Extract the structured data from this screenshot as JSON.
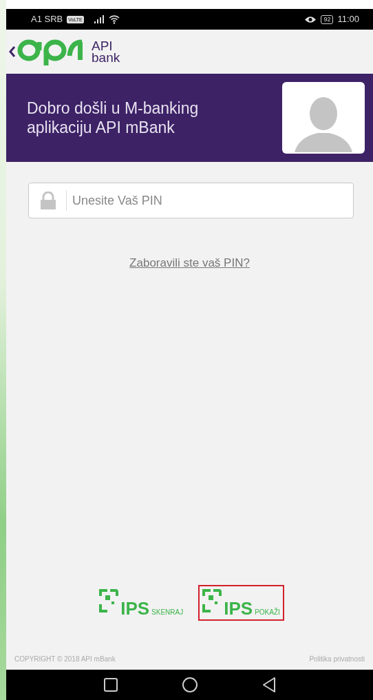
{
  "status_bar": {
    "carrier": "A1 SRB",
    "network_badge": "VoLTE",
    "battery": "92",
    "time": "11:00"
  },
  "header": {
    "logo_line1": "API",
    "logo_line2": "bank"
  },
  "banner": {
    "title": "Dobro došli u M-banking aplikaciju API mBank"
  },
  "pin_field": {
    "placeholder": "Unesite Vaš PIN"
  },
  "forgot_link": "Zaboravili ste vaš PIN?",
  "ips_buttons": [
    {
      "brand": "IPS",
      "label": "SKENRAJ",
      "selected": false
    },
    {
      "brand": "IPS",
      "label": "POKAŽI",
      "selected": true
    }
  ],
  "footer": {
    "copyright": "COPYRIGHT © 2018 API mBank",
    "privacy": "Politika privatnosti"
  }
}
